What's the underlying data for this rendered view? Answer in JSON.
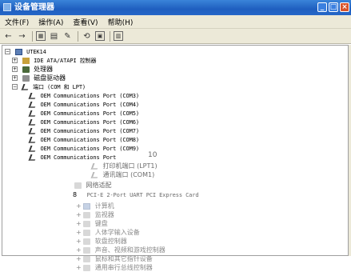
{
  "window": {
    "title": "设备管理器",
    "controls": [
      "_",
      "□",
      "×"
    ]
  },
  "menubar": {
    "items": [
      "文件(F)",
      "操作(A)",
      "查看(V)",
      "帮助(H)"
    ]
  },
  "toolbar": {
    "buttons": [
      "back-arrow-icon",
      "forward-arrow-icon",
      "properties-icon",
      "print-icon",
      "help-icon",
      "refresh-icon",
      "scan-icon"
    ]
  },
  "tree": {
    "root": "UTEK14",
    "categories": [
      "IDE ATA/ATAPI 控制器",
      "处理器",
      "磁盘驱动器",
      "端口 (COM 和 LPT)"
    ],
    "ports": [
      "OEM Communications Port (COM3)",
      "OEM Communications Port (COM4)",
      "OEM Communications Port (COM5)",
      "OEM Communications Port (COM6)",
      "OEM Communications Port (COM7)",
      "OEM Communications Port (COM8)",
      "OEM Communications Port (COM9)",
      "OEM Communications Port"
    ],
    "ports_extra": [
      "打印机端口 (LPT1)",
      "通讯端口 (COM1)"
    ],
    "number_overlay": "10",
    "lower": {
      "network": "网络适配",
      "pci_number": "8",
      "pci_card": "PCI-E 2-Port UART PCI Express Card",
      "categories": [
        "计算机",
        "监视器",
        "键盘",
        "人体学输入设备",
        "软盘控制器",
        "声音、视频和游戏控制器",
        "鼠标和其它指针设备",
        "通用串行总线控制器"
      ]
    }
  }
}
